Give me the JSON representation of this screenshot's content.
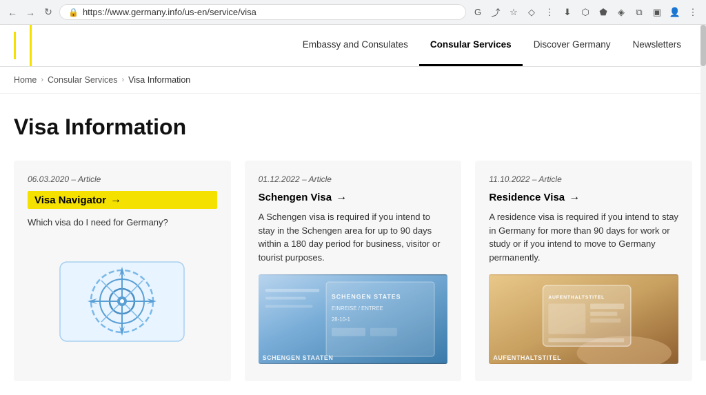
{
  "browser": {
    "url": "https://www.germany.info/us-en/service/visa",
    "lock_icon": "🔒"
  },
  "nav": {
    "links": [
      {
        "label": "Embassy and Consulates",
        "active": false
      },
      {
        "label": "Consular Services",
        "active": true
      },
      {
        "label": "Discover Germany",
        "active": false
      },
      {
        "label": "Newsletters",
        "active": false
      }
    ]
  },
  "breadcrumb": {
    "home": "Home",
    "section": "Consular Services",
    "current": "Visa Information"
  },
  "page": {
    "title": "Visa Information"
  },
  "cards": [
    {
      "date": "06.03.2020 – Article",
      "title": "Visa Navigator",
      "arrow": "→",
      "highlighted": true,
      "description": "Which visa do I need for Germany?",
      "image_type": "illustration"
    },
    {
      "date": "01.12.2022 – Article",
      "title": "Schengen Visa",
      "arrow": "→",
      "highlighted": false,
      "description": "A Schengen visa is required if you intend to stay in the Schengen area for up to 90 days within a 180 day period for business, visitor or tourist purposes.",
      "image_type": "schengen"
    },
    {
      "date": "11.10.2022 – Article",
      "title": "Residence Visa",
      "arrow": "→",
      "highlighted": false,
      "description": "A residence visa is required if you intend to stay in Germany for more than 90 days for work or study or if you intend to move to Germany permanently.",
      "image_type": "residence"
    }
  ]
}
